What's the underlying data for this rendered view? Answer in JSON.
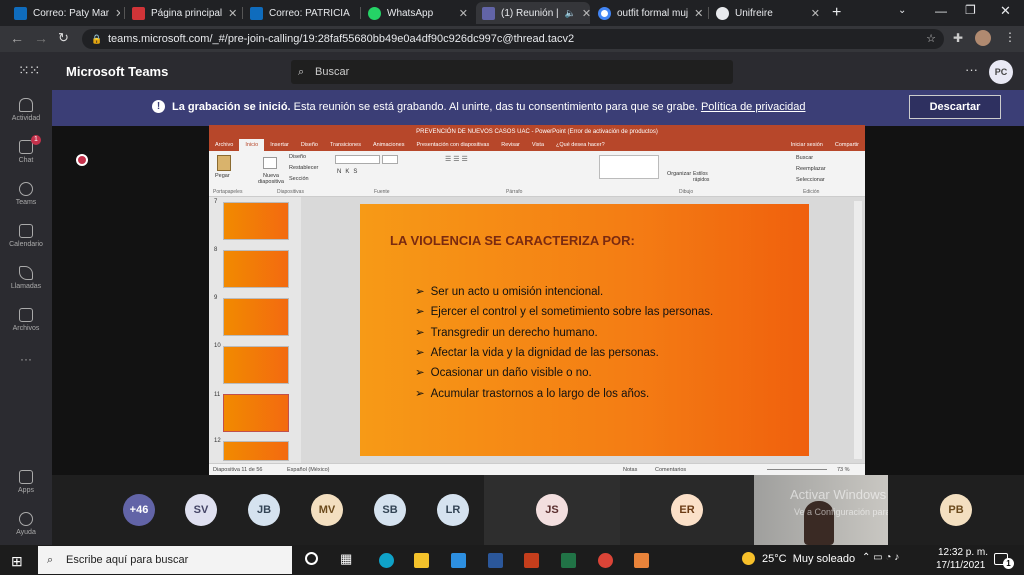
{
  "browser": {
    "tabs": [
      {
        "title": "Correo: Paty Mar",
        "color": "#0f6cbd"
      },
      {
        "title": "Página principal",
        "color": "#d13438"
      },
      {
        "title": "Correo: PATRICIA",
        "color": "#0f6cbd"
      },
      {
        "title": "WhatsApp",
        "color": "#25d366"
      },
      {
        "title": "(1) Reunión |",
        "color": "#6264a7"
      },
      {
        "title": "outfit formal muj",
        "color": "#4285f4"
      },
      {
        "title": "Unifreire",
        "color": "#e8eaed"
      }
    ],
    "url": "teams.microsoft.com/_#/pre-join-calling/19:28faf55680bb49e0a4df90c926dc997c@thread.tacv2"
  },
  "teams": {
    "app_name": "Microsoft Teams",
    "search_placeholder": "Buscar",
    "user_initials": "PC",
    "rail": [
      "Actividad",
      "Chat",
      "Teams",
      "Calendario",
      "Llamadas",
      "Archivos",
      "Apps",
      "Ayuda"
    ],
    "chat_badge": "1",
    "banner": {
      "bold": "La grabación se inició.",
      "text": "Esta reunión se está grabando. Al unirte, das tu consentimiento para que se grabe.",
      "link": "Política de privacidad",
      "button": "Descartar"
    }
  },
  "powerpoint": {
    "title": "PREVENCIÓN DE NUEVOS CASOS UAC - PowerPoint (Error de activación de productos)",
    "tabs": [
      "Archivo",
      "Inicio",
      "Insertar",
      "Diseño",
      "Transiciones",
      "Animaciones",
      "Presentación con diapositivas",
      "Revisar",
      "Vista",
      "¿Qué desea hacer?"
    ],
    "right_tabs": [
      "Iniciar sesión",
      "Compartir"
    ],
    "ribbon_groups": [
      "Portapapeles",
      "Diapositivas",
      "Fuente",
      "Párrafo",
      "Dibujo",
      "Edición"
    ],
    "ribbon_buttons": {
      "paste": "Pegar",
      "new_slide": "Nueva diapositiva",
      "layout": "Diseño",
      "reset": "Restablecer",
      "section": "Sección",
      "arrange": "Organizar",
      "quick_styles": "Estilos rápidos",
      "find": "Buscar",
      "replace": "Reemplazar",
      "select": "Seleccionar"
    },
    "thumb_numbers": [
      "7",
      "8",
      "9",
      "10",
      "11",
      "12"
    ],
    "slide": {
      "title": "LA VIOLENCIA SE CARACTERIZA POR:",
      "bullets": [
        "Ser un acto u omisión intencional.",
        "Ejercer el control y el  sometimiento sobre las personas.",
        "Transgredir  un derecho humano.",
        "Afectar la vida y la dignidad de las personas.",
        "Ocasionar un daño visible o no.",
        "Acumular trastornos  a lo largo de los años."
      ]
    },
    "status": {
      "slide": "Diapositiva 11 de 56",
      "language": "Español (México)",
      "notes": "Notas",
      "comments": "Comentarios",
      "zoom": "73 %"
    }
  },
  "participants": [
    {
      "initials": "+46",
      "bg": "#6264a7",
      "fg": "#ffffff"
    },
    {
      "initials": "SV",
      "bg": "#dfe0f0",
      "fg": "#444466"
    },
    {
      "initials": "JB",
      "bg": "#d5e2ef",
      "fg": "#334455"
    },
    {
      "initials": "MV",
      "bg": "#f3dfc0",
      "fg": "#6b4a1c"
    },
    {
      "initials": "SB",
      "bg": "#d5e2ef",
      "fg": "#334455"
    },
    {
      "initials": "LR",
      "bg": "#d5e2ef",
      "fg": "#334455"
    },
    {
      "initials": "JS",
      "bg": "#f3dfdf",
      "fg": "#5a2e2e"
    },
    {
      "initials": "ER",
      "bg": "#fbe0c8",
      "fg": "#6b3a14"
    },
    {
      "initials": "PB",
      "bg": "#f3dfc0",
      "fg": "#6b4a1c"
    }
  ],
  "watermark": {
    "line1": "Activar Windows",
    "line2": "Ve a Configuración para activar Windows."
  },
  "taskbar": {
    "search_placeholder": "Escribe aquí para buscar",
    "weather": "25°C  Muy soleado",
    "time": "12:32 p. m.",
    "date": "17/11/2021",
    "notif_count": "1"
  }
}
